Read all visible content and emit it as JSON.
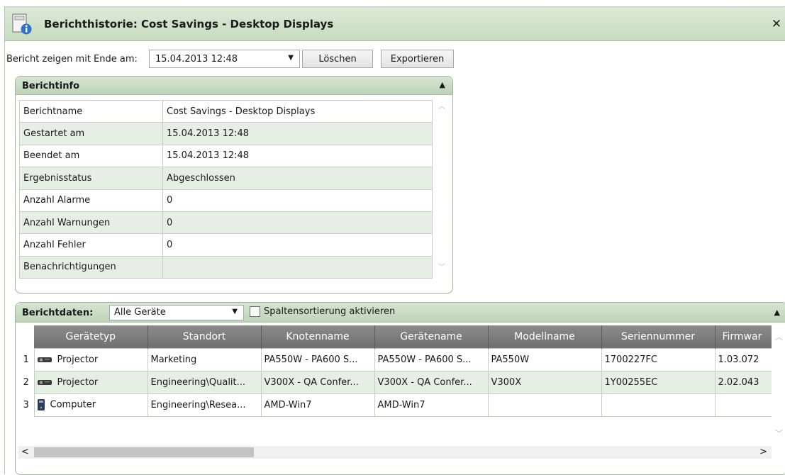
{
  "window": {
    "title": "Berichthistorie: Cost Savings - Desktop Displays",
    "close": "✕"
  },
  "toolbar": {
    "label": "Bericht zeigen mit Ende am:",
    "date_value": "15.04.2013 12:48",
    "delete_label": "Löschen",
    "export_label": "Exportieren"
  },
  "info_panel": {
    "title": "Berichtinfo",
    "rows": [
      {
        "key": "Berichtname",
        "value": "Cost Savings - Desktop Displays"
      },
      {
        "key": "Gestartet am",
        "value": "15.04.2013 12:48"
      },
      {
        "key": "Beendet am",
        "value": "15.04.2013 12:48"
      },
      {
        "key": "Ergebnisstatus",
        "value": "Abgeschlossen"
      },
      {
        "key": "Anzahl Alarme",
        "value": "0"
      },
      {
        "key": "Anzahl Warnungen",
        "value": "0"
      },
      {
        "key": "Anzahl Fehler",
        "value": "0"
      },
      {
        "key": "Benachrichtigungen",
        "value": ""
      }
    ]
  },
  "data_panel": {
    "title": "Berichtdaten:",
    "filter_value": "Alle Geräte",
    "sort_checkbox_label": "Spaltensortierung aktivieren",
    "sort_checked": false,
    "columns": [
      "Gerätetyp",
      "Standort",
      "Knotenname",
      "Gerätename",
      "Modellname",
      "Seriennummer",
      "Firmwar"
    ],
    "rows": [
      {
        "num": "1",
        "icon": "projector-icon",
        "type": "Projector",
        "location": "Marketing",
        "node": "PA550W - PA600 S...",
        "device": "PA550W - PA600 S...",
        "model": "PA550W",
        "serial": "1700227FC",
        "firmware": "1.03.072"
      },
      {
        "num": "2",
        "icon": "projector-icon",
        "type": "Projector",
        "location": "Engineering\\Qualit...",
        "node": "V300X - QA Confer...",
        "device": "V300X - QA Confer...",
        "model": "V300X",
        "serial": "1Y00255EC",
        "firmware": "2.02.043"
      },
      {
        "num": "3",
        "icon": "computer-icon",
        "type": "Computer",
        "location": "Engineering\\Resea...",
        "node": "AMD-Win7",
        "device": "AMD-Win7",
        "model": "",
        "serial": "",
        "firmware": ""
      }
    ]
  },
  "colors": {
    "title_bar": "#c7dcc1",
    "alt_row": "#e6efe3",
    "grid_header": "#7a7a7a"
  }
}
